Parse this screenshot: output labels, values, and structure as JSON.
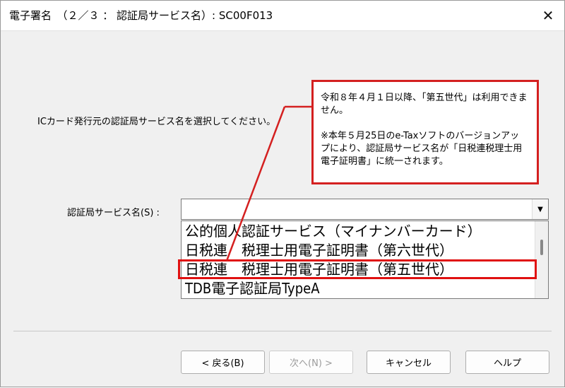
{
  "window": {
    "title": "電子署名　（２／３ ： 認証局サービス名）: SC00F013",
    "close_glyph": "✕"
  },
  "instruction": "ICカード発行元の認証局サービス名を選択してください。",
  "field": {
    "label": "認証局サービス名(S) :",
    "value": ""
  },
  "list": {
    "items": [
      "公的個人認証サービス（マイナンバーカード）",
      "日税連　税理士用電子証明書（第六世代）",
      "日税連　税理士用電子証明書（第五世代）",
      "TDB電子認証局TypeA"
    ],
    "highlighted_item": "日税連　税理士用電子証明書（第五世代）"
  },
  "callout": {
    "line1": "令和８年４月１日以降、「第五世代」は利用できません。",
    "line2": "※本年５月25日のe-Taxソフトのバージョンアップにより、認証局サービス名が「日税連税理士用電子証明書」に統一されます。",
    "border_color": "#d42020"
  },
  "buttons": {
    "back": "< 戻る(B)",
    "next": "次へ(N) >",
    "cancel": "キャンセル",
    "help": "ヘルプ"
  }
}
